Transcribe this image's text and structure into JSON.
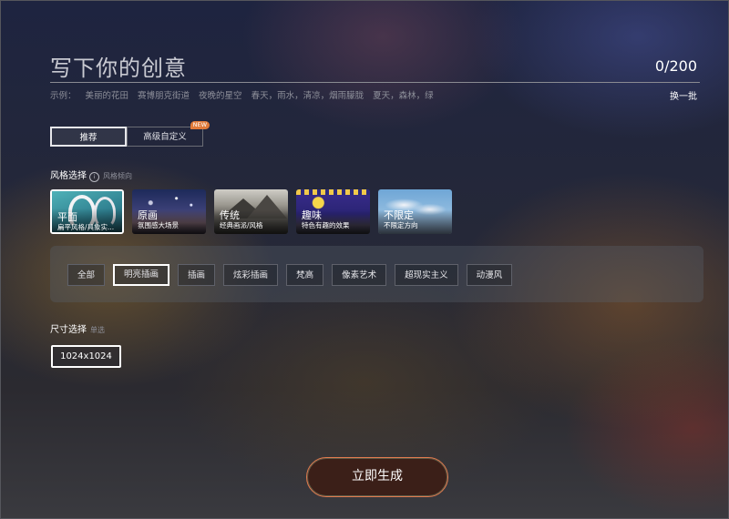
{
  "prompt": {
    "title": "写下你的创意",
    "char_count": "0/200",
    "examples_label": "示例：",
    "examples": [
      "美丽的花田",
      "赛博朋克街道",
      "夜晚的星空",
      "春天，雨水，清凉，烟雨朦胧",
      "夏天，森林，绿"
    ],
    "refresh_label": "换一批"
  },
  "mode_tabs": {
    "recommend_label": "推荐",
    "advanced_label": "高级自定义",
    "new_badge": "NEW"
  },
  "style": {
    "section_label": "风格选择",
    "info_glyph": "i",
    "hint": "风格倾向",
    "cards": [
      {
        "name": "平面",
        "desc": "扁平风格/具象实..."
      },
      {
        "name": "原画",
        "desc": "氛围感大场景"
      },
      {
        "name": "传统",
        "desc": "经典画派/风格"
      },
      {
        "name": "趣味",
        "desc": "特色有趣的效果"
      },
      {
        "name": "不限定",
        "desc": "不限定方向"
      }
    ],
    "selected_index": 0
  },
  "filters": {
    "chips": [
      "全部",
      "明亮插画",
      "插画",
      "炫彩插画",
      "梵高",
      "像素艺术",
      "超现实主义",
      "动漫风"
    ],
    "active_index": 1
  },
  "size": {
    "section_label": "尺寸选择",
    "hint": "单选",
    "value": "1024x1024"
  },
  "generate_label": "立即生成",
  "colors": {
    "accent_orange": "#e27a4f",
    "badge": "#e07a3a"
  }
}
